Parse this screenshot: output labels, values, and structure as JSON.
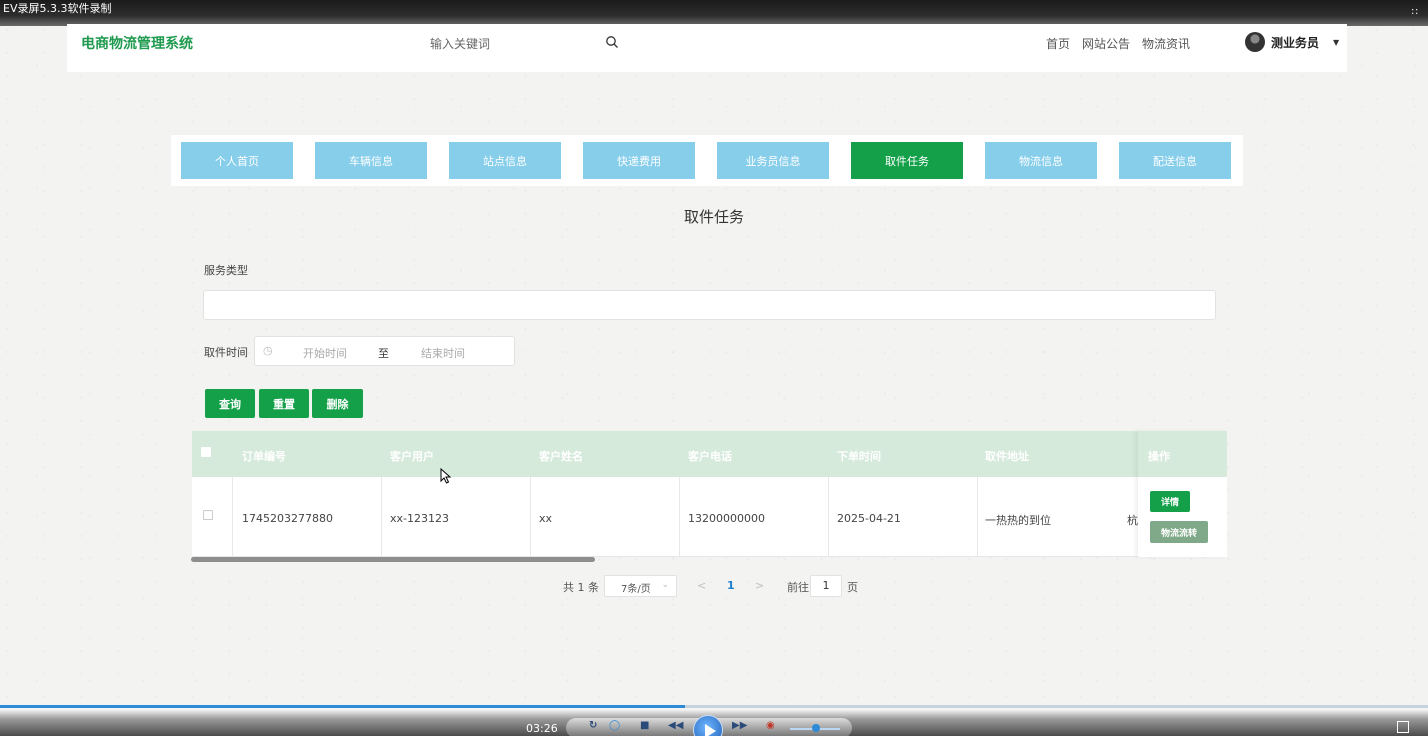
{
  "recorder": {
    "title": "EV录屏5.3.3软件录制",
    "time": "03:26",
    "progress_pct": 48
  },
  "header": {
    "logo": "电商物流管理系统",
    "search_placeholder": "输入关键词",
    "nav": [
      "首页",
      "网站公告",
      "物流资讯"
    ],
    "user": "测业务员"
  },
  "tabs": [
    {
      "label": "个人首页",
      "active": false
    },
    {
      "label": "车辆信息",
      "active": false
    },
    {
      "label": "站点信息",
      "active": false
    },
    {
      "label": "快递费用",
      "active": false
    },
    {
      "label": "业务员信息",
      "active": false
    },
    {
      "label": "取件任务",
      "active": true
    },
    {
      "label": "物流信息",
      "active": false
    },
    {
      "label": "配送信息",
      "active": false
    }
  ],
  "page_title": "取件任务",
  "filters": {
    "service_type_label": "服务类型",
    "service_type_value": "",
    "time_label": "取件时间",
    "start_placeholder": "开始时间",
    "separator": "至",
    "end_placeholder": "结束时间"
  },
  "actions": {
    "query": "查询",
    "reset": "重置",
    "delete": "删除"
  },
  "table": {
    "columns": [
      "订单编号",
      "客户用户",
      "客户姓名",
      "客户电话",
      "下单时间",
      "取件地址"
    ],
    "op_column": "操作",
    "rows": [
      {
        "cells": [
          "1745203277880",
          "xx-123123",
          "xx",
          "13200000000",
          "2025-04-21",
          "一热热的到位"
        ],
        "overflow_text": "杭"
      }
    ],
    "row_buttons": {
      "detail": "详情",
      "flow": "物流流转"
    }
  },
  "pagination": {
    "total": "共 1 条",
    "page_size": "7条/页",
    "current_page": "1",
    "goto_label": "前往",
    "goto_value": "1",
    "page_unit": "页"
  },
  "colors": {
    "accent": "#13a049",
    "tab": "#87ceeb",
    "header_row": "#d6eadb",
    "flow_button": "#7fa988"
  }
}
